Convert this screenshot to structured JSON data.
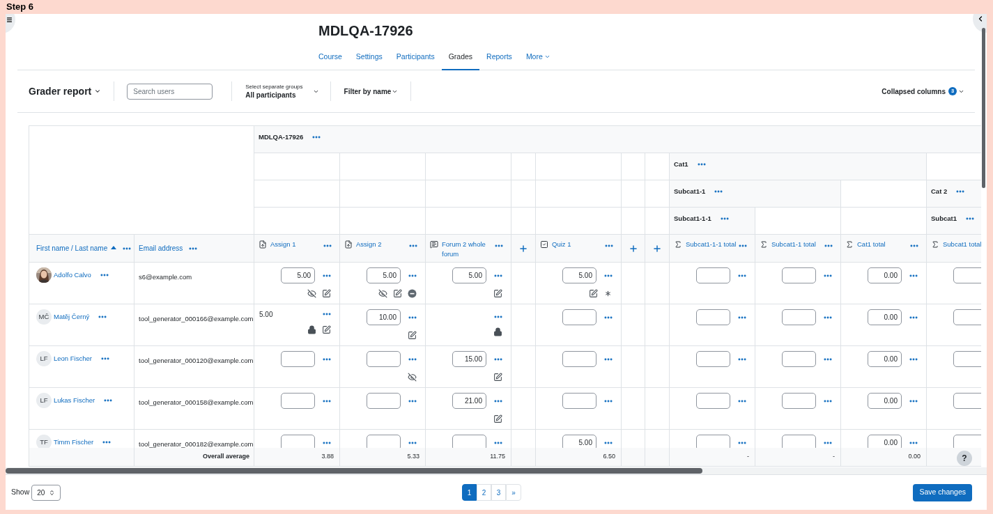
{
  "step_label": "Step 6",
  "course_title": "MDLQA-17926",
  "nav": [
    {
      "label": "Course",
      "selected": false,
      "dropdown": false
    },
    {
      "label": "Settings",
      "selected": false,
      "dropdown": false
    },
    {
      "label": "Participants",
      "selected": false,
      "dropdown": false
    },
    {
      "label": "Grades",
      "selected": true,
      "dropdown": false
    },
    {
      "label": "Reports",
      "selected": false,
      "dropdown": false
    },
    {
      "label": "More",
      "selected": false,
      "dropdown": true
    }
  ],
  "toolbar": {
    "report_menu": "Grader report",
    "search": {
      "placeholder": "Search users"
    },
    "groups": {
      "label": "Select separate groups",
      "value": "All participants"
    },
    "filter": "Filter by name",
    "collapsed": {
      "label": "Collapsed columns",
      "count": "3"
    }
  },
  "table": {
    "header_rows": [
      [
        "MDLQA-17926"
      ],
      [
        "Cat1"
      ],
      [
        "Subcat1-1",
        "Cat 2"
      ],
      [
        "Subcat1-1-1",
        "Subcat1"
      ]
    ],
    "columns": [
      {
        "kind": "user",
        "label": "First name / Last name",
        "sorted": true
      },
      {
        "kind": "email",
        "label": "Email address",
        "sorted": false
      },
      {
        "kind": "assign",
        "label": "Assign 1"
      },
      {
        "kind": "assign",
        "label": "Assign 2"
      },
      {
        "kind": "forum",
        "label": "Forum 2 whole forum"
      },
      {
        "kind": "add"
      },
      {
        "kind": "quiz",
        "label": "Quiz 1"
      },
      {
        "kind": "add"
      },
      {
        "kind": "add"
      },
      {
        "kind": "total",
        "label": "Subcat1-1-1 total"
      },
      {
        "kind": "total",
        "label": "Subcat1-1 total"
      },
      {
        "kind": "total",
        "label": "Cat1 total"
      },
      {
        "kind": "total",
        "label": "Subcat1 total"
      }
    ],
    "rows": [
      {
        "cells": [
          {
            "kind": "user",
            "name": "Adolfo Calvo"
          },
          {
            "kind": "email",
            "value": "s6@example.com"
          },
          {
            "kind": "input",
            "value": "5.00",
            "icons": [
              {
                "kind": "hidden"
              },
              {
                "kind": "edit"
              }
            ]
          },
          {
            "kind": "input",
            "value": "5.00",
            "icons": [
              {
                "kind": "hidden"
              },
              {
                "kind": "edit"
              },
              {
                "kind": "excluded"
              }
            ]
          },
          {
            "kind": "input",
            "value": "5.00",
            "icons": [
              {
                "kind": "edit"
              }
            ]
          },
          {
            "kind": "empty"
          },
          {
            "kind": "input",
            "value": "5.00",
            "icons": [
              {
                "kind": "edit"
              },
              {
                "kind": "overridden"
              }
            ]
          },
          {
            "kind": "empty"
          },
          {
            "kind": "empty"
          },
          {
            "kind": "input"
          },
          {
            "kind": "input"
          },
          {
            "kind": "input",
            "value": "0.00"
          },
          {
            "kind": "input"
          }
        ]
      },
      {
        "cells": [
          {
            "kind": "user",
            "name": "Matěj Černý",
            "avatar": {
              "kind": "initials",
              "text": "MČ"
            }
          },
          {
            "kind": "email",
            "value": "tool_generator_000166@example.com"
          },
          {
            "kind": "text",
            "value": "5.00",
            "icons": [
              {
                "kind": "locked"
              },
              {
                "kind": "edit"
              }
            ]
          },
          {
            "kind": "input",
            "value": "10.00",
            "icons": [
              {
                "kind": "edit"
              }
            ]
          },
          {
            "kind": "menu_only",
            "icons": [
              {
                "kind": "locked"
              }
            ]
          },
          {
            "kind": "empty"
          },
          {
            "kind": "input"
          },
          {
            "kind": "empty"
          },
          {
            "kind": "empty"
          },
          {
            "kind": "input"
          },
          {
            "kind": "input"
          },
          {
            "kind": "input",
            "value": "0.00"
          },
          {
            "kind": "input"
          }
        ]
      },
      {
        "cells": [
          {
            "kind": "user",
            "name": "Leon Fischer",
            "avatar": {
              "kind": "initials",
              "text": "LF"
            }
          },
          {
            "kind": "email",
            "value": "tool_generator_000120@example.com"
          },
          {
            "kind": "input"
          },
          {
            "kind": "input",
            "icons": [
              {
                "kind": "hidden"
              }
            ]
          },
          {
            "kind": "input",
            "value": "15.00",
            "icons": [
              {
                "kind": "edit"
              }
            ]
          },
          {
            "kind": "empty"
          },
          {
            "kind": "input"
          },
          {
            "kind": "empty"
          },
          {
            "kind": "empty"
          },
          {
            "kind": "input"
          },
          {
            "kind": "input"
          },
          {
            "kind": "input",
            "value": "0.00"
          },
          {
            "kind": "input"
          }
        ]
      },
      {
        "cells": [
          {
            "kind": "user",
            "name": "Lukas Fischer",
            "avatar": {
              "kind": "initials",
              "text": "LF"
            }
          },
          {
            "kind": "email",
            "value": "tool_generator_000158@example.com"
          },
          {
            "kind": "input"
          },
          {
            "kind": "input"
          },
          {
            "kind": "input",
            "value": "21.00",
            "icons": [
              {
                "kind": "edit"
              }
            ]
          },
          {
            "kind": "empty"
          },
          {
            "kind": "input"
          },
          {
            "kind": "empty"
          },
          {
            "kind": "empty"
          },
          {
            "kind": "input"
          },
          {
            "kind": "input"
          },
          {
            "kind": "input",
            "value": "0.00"
          },
          {
            "kind": "input"
          }
        ]
      },
      {
        "cells": [
          {
            "kind": "user",
            "name": "Timm Fischer",
            "avatar": {
              "kind": "initials",
              "text": "TF"
            }
          },
          {
            "kind": "email",
            "value": "tool_generator_000182@example.com"
          },
          {
            "kind": "input"
          },
          {
            "kind": "input"
          },
          {
            "kind": "input"
          },
          {
            "kind": "empty"
          },
          {
            "kind": "input",
            "value": "5.00"
          },
          {
            "kind": "empty"
          },
          {
            "kind": "empty"
          },
          {
            "kind": "input"
          },
          {
            "kind": "input"
          },
          {
            "kind": "input",
            "value": "0.00"
          },
          {
            "kind": "input"
          }
        ]
      }
    ],
    "average": [
      {
        "kind": "blank"
      },
      {
        "kind": "label",
        "text": "Overall average"
      },
      {
        "kind": "value",
        "text": "3.88"
      },
      {
        "kind": "value",
        "text": "5.33"
      },
      {
        "kind": "value",
        "text": "11.75"
      },
      {
        "kind": "blank"
      },
      {
        "kind": "value",
        "text": "6.50"
      },
      {
        "kind": "blank"
      },
      {
        "kind": "blank"
      },
      {
        "kind": "value",
        "text": "-"
      },
      {
        "kind": "value",
        "text": "-"
      },
      {
        "kind": "value",
        "text": "0.00"
      },
      {
        "kind": "blank"
      }
    ]
  },
  "help_button": "?",
  "footer": {
    "show_label": "Show",
    "per_page": "20",
    "pages": [
      {
        "label": "1",
        "selected": true
      },
      {
        "label": "2",
        "selected": false
      },
      {
        "label": "3",
        "selected": false
      }
    ],
    "next": "»",
    "save": "Save changes"
  }
}
